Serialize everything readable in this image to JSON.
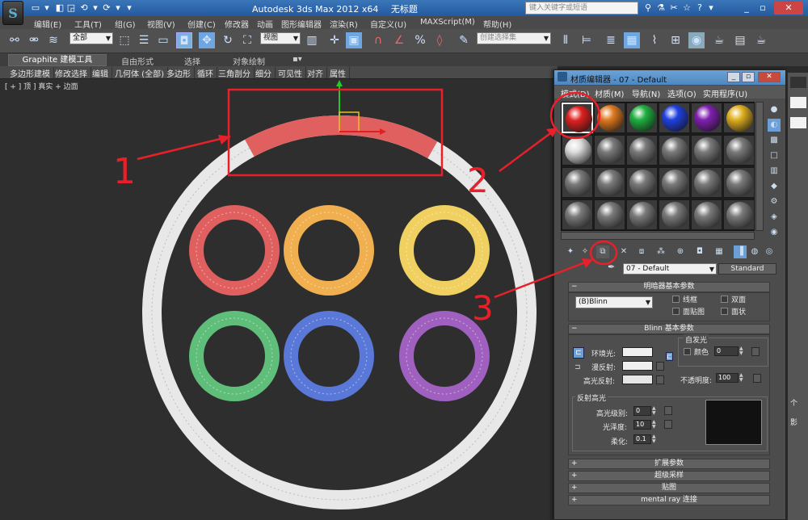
{
  "app": {
    "logo_glyph": "S",
    "title": "Autodesk 3ds Max  2012 x64",
    "doc": "无标题",
    "search_placeholder": "键入关键字或短语",
    "quick_access": [
      "▭",
      "▾",
      "◧",
      "◲",
      "⟲",
      "▾",
      "⟳",
      "▾",
      "▾"
    ],
    "title_icons": [
      "⚲",
      "⚗",
      "✂",
      "☆",
      "?",
      "▾",
      "_",
      "▫",
      "✕"
    ]
  },
  "menu": [
    "编辑(E)",
    "工具(T)",
    "组(G)",
    "视图(V)",
    "创建(C)",
    "修改器",
    "动画",
    "图形编辑器",
    "渲染(R)",
    "自定义(U)",
    "MAXScript(M)",
    "帮助(H)"
  ],
  "toolbar": {
    "selection_filter": "全部",
    "ref_coord": "视图",
    "named_selection": "创建选择集",
    "icons": [
      "link-icon",
      "unlink-icon",
      "bind-space-warp-icon",
      "select-object-icon",
      "select-by-name-icon",
      "rect-region-icon",
      "window-crossing-icon",
      "move-icon",
      "rotate-icon",
      "scale-icon",
      "pivot-icon",
      "select-manipulate-icon",
      "snap-icon",
      "angle-snap-icon",
      "percent-snap-icon",
      "spinner-snap-icon",
      "edit-named-sel-icon",
      "mirror-icon",
      "align-icon",
      "layer-icon",
      "graphite-toggle-icon",
      "curve-editor-icon",
      "schematic-icon",
      "material-editor-icon",
      "render-setup-icon",
      "render-frame-icon",
      "render-icon"
    ]
  },
  "ribbon": {
    "tabs": [
      "Graphite 建模工具",
      "自由形式",
      "选择",
      "对象绘制"
    ],
    "tab_menu_glyph": "▪▾",
    "subtabs": [
      "多边形建模",
      "修改选择",
      "编辑",
      "几何体 (全部)",
      "多边形",
      "循环",
      "三角剖分",
      "细分",
      "可见性",
      "对齐",
      "属性"
    ]
  },
  "viewport": {
    "label": "[ + ] 顶 ] 真实 + 边面",
    "annotations": [
      "1",
      "2",
      "3"
    ],
    "ring_colors": [
      "#e06060",
      "#f0b050",
      "#f0d060",
      "#5fbf7a",
      "#5a78d8",
      "#a060c0"
    ],
    "annotation_color": "#e8202a"
  },
  "material_editor": {
    "title": "材质编辑器 - 07 - Default",
    "menus": [
      "模式(D)",
      "材质(M)",
      "导航(N)",
      "选项(O)",
      "实用程序(U)"
    ],
    "slot_colors_row1": [
      "#e02020",
      "#e07a20",
      "#20b040",
      "#2040e0",
      "#8020b0",
      "#e0b020"
    ],
    "current_material": "07 - Default",
    "material_type": "Standard",
    "shader_rollout": {
      "title": "明暗器基本参数",
      "shader": "(B)Blinn",
      "options": [
        "线框",
        "双面",
        "面贴图",
        "面状"
      ]
    },
    "blinn_rollout": {
      "title": "Blinn 基本参数",
      "self_illum_group": "自发光",
      "self_illum_color_label": "颜色",
      "self_illum_value": "0",
      "ambient": "环境光:",
      "diffuse": "漫反射:",
      "specular": "高光反射:",
      "lock_glyph": "⊏",
      "ambient_map_glyph": "⊏",
      "opacity_label": "不透明度:",
      "opacity_value": "100",
      "spec_group": "反射高光",
      "spec_level_label": "高光级别:",
      "spec_level": "0",
      "gloss_label": "光泽度:",
      "gloss": "10",
      "soften_label": "柔化:",
      "soften": "0.1"
    },
    "collapsed_rollouts": [
      "扩展参数",
      "超级采样",
      "贴图",
      "mental ray 连接"
    ]
  },
  "right_panel": {
    "items": [
      "个",
      "影"
    ]
  }
}
